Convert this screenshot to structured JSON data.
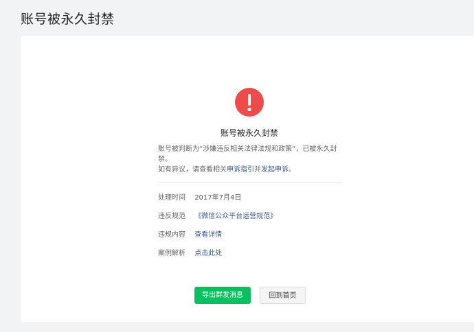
{
  "page": {
    "title": "账号被永久封禁"
  },
  "notice": {
    "icon": "exclamation-circle-icon",
    "icon_color": "#f04b4b",
    "title": "账号被永久封禁",
    "desc_line1": "账号被判断为“涉嫌违反相关法律法规和政策”，已被永久封禁。",
    "desc_line2_prefix": "如有异议，请查看相关",
    "desc_link1": "申诉指引",
    "desc_link_joiner": "并",
    "desc_link2": "发起申诉",
    "desc_line2_suffix": "。"
  },
  "details": [
    {
      "label": "处理时间",
      "value": "2017年7月4日"
    },
    {
      "label": "违反规范",
      "value": "《微信公众平台运营规范》"
    },
    {
      "label": "违规内容",
      "value": "查看详情"
    },
    {
      "label": "案例解析",
      "value": "点击此处"
    }
  ],
  "actions": {
    "export_label": "导出群发消息",
    "home_label": "回到首页"
  },
  "colors": {
    "primary_button": "#07c160",
    "link": "#3b5a8a"
  }
}
